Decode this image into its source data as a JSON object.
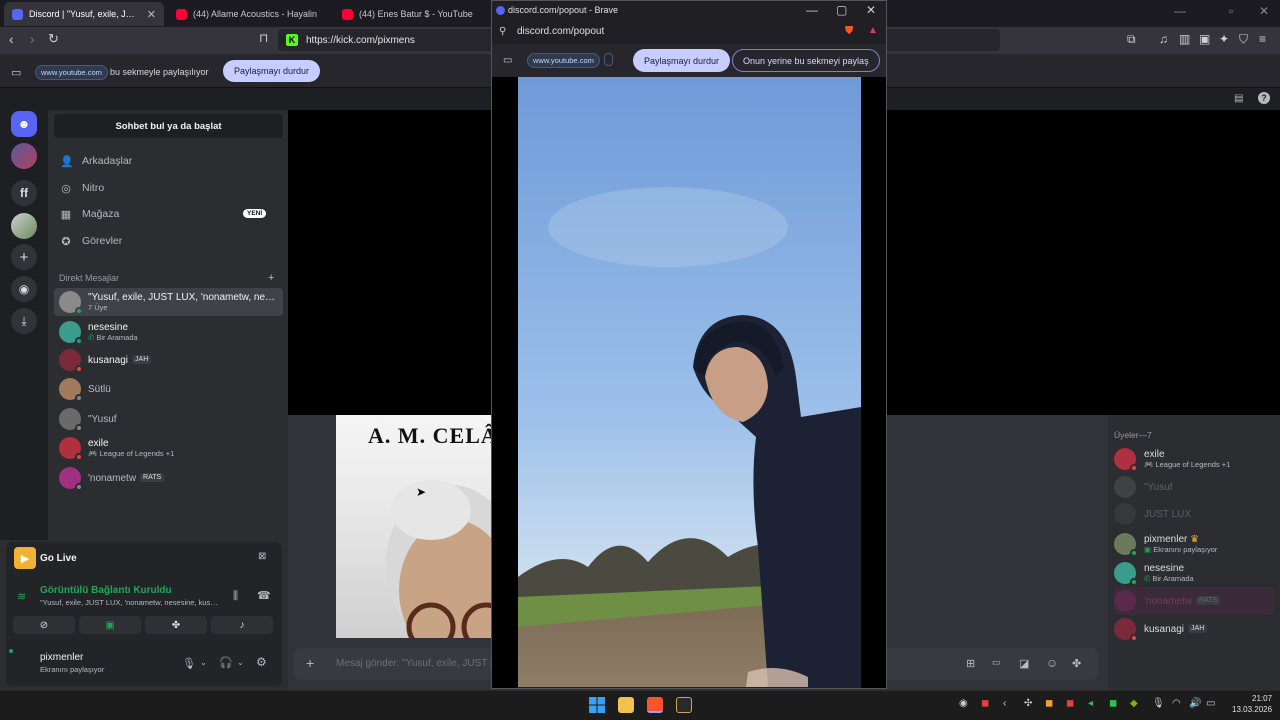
{
  "browser": {
    "tabs": [
      {
        "label": "Discord | \"Yusuf, exile, JUST LUX, 'nonametw, nesesine, kus...",
        "active": true
      },
      {
        "label": "(44) Allame Acoustics - Hayalin Yüzünden",
        "active": false
      },
      {
        "label": "(44) Enes Batur $ - YouTube",
        "active": false
      }
    ],
    "url": "https://kick.com/pixmens",
    "share_bar": {
      "domain_pill": "www.youtube.com",
      "message": "bu sekmeyle paylaşılıyor",
      "stop_label": "Paylaşmayı durdur"
    }
  },
  "popout": {
    "window_title": "discord.com/popout - Brave",
    "url": "discord.com/popout",
    "domain_pill": "www.youtube.com",
    "stop_label": "Paylaşmayı durdur",
    "share_instead_label": "Onun yerine bu sekmeyi paylaş"
  },
  "discord": {
    "search_label": "Sohbet bul ya da başlat",
    "nav": [
      {
        "label": "Arkadaşlar",
        "icon": "friends-icon"
      },
      {
        "label": "Nitro",
        "icon": "nitro-icon"
      },
      {
        "label": "Mağaza",
        "icon": "shop-icon",
        "badge": "YENİ"
      },
      {
        "label": "Görevler",
        "icon": "quests-icon"
      }
    ],
    "dm_header": "Direkt Mesajlar",
    "dms": [
      {
        "name": "\"Yusuf, exile, JUST LUX, 'nonametw, nesesine, kusanagi",
        "sub": "7 Üye",
        "selected": true,
        "color": "#8a8a8a"
      },
      {
        "name": "nesesine",
        "sub": "Bir Aramada",
        "color": "#3a9c8a"
      },
      {
        "name": "kusanagi",
        "tag": "JAH",
        "color": "#7a2a3a"
      },
      {
        "name": "Sütlü",
        "color": "#a07a5a"
      },
      {
        "name": "\"Yusuf",
        "color": "#6a6a6a"
      },
      {
        "name": "exile",
        "sub": "League of Legends +1",
        "color": "#b03040"
      },
      {
        "name": "'nonametw",
        "tag": "RATS",
        "color": "#a03080"
      }
    ],
    "golive_title": "Go Live",
    "voice_status": "Görüntülü Bağlantı Kuruldu",
    "voice_channel": "\"Yusuf, exile, JUST LUX, 'nonametw, nesesine, kusanagi",
    "user": {
      "name": "pixmenler",
      "status": "Ekranını paylaşıyor"
    },
    "message_placeholder": "Mesaj gönder: \"Yusuf, exile, JUST LUX, 'nonametw, nesesine, kusanagi",
    "members_header": "Üyeler—7",
    "members": [
      {
        "name": "exile",
        "sub": "League of Legends +1",
        "dim": false,
        "color": "#b03040"
      },
      {
        "name": "\"Yusuf",
        "sub": "",
        "dim": true,
        "color": "#555"
      },
      {
        "name": "JUST LUX",
        "sub": "",
        "dim": true,
        "color": "#444"
      },
      {
        "name": "pixmenler",
        "sub": "Ekranını paylaşıyor",
        "dim": false,
        "crown": "♛",
        "color": "#6a7a5a"
      },
      {
        "name": "nesesine",
        "sub": "Bir Aramada",
        "dim": false,
        "color": "#3a9c8a"
      },
      {
        "name": "'nonametw",
        "sub": "",
        "dim": true,
        "tag": "RATS",
        "color": "#7a2a5a"
      },
      {
        "name": "kusanagi",
        "sub": "",
        "dim": false,
        "tag": "JAH",
        "color": "#7a2a3a"
      }
    ],
    "book_title": "A. M. CELÂL"
  },
  "taskbar": {
    "time": "21:07",
    "date": "13.03.2026"
  }
}
